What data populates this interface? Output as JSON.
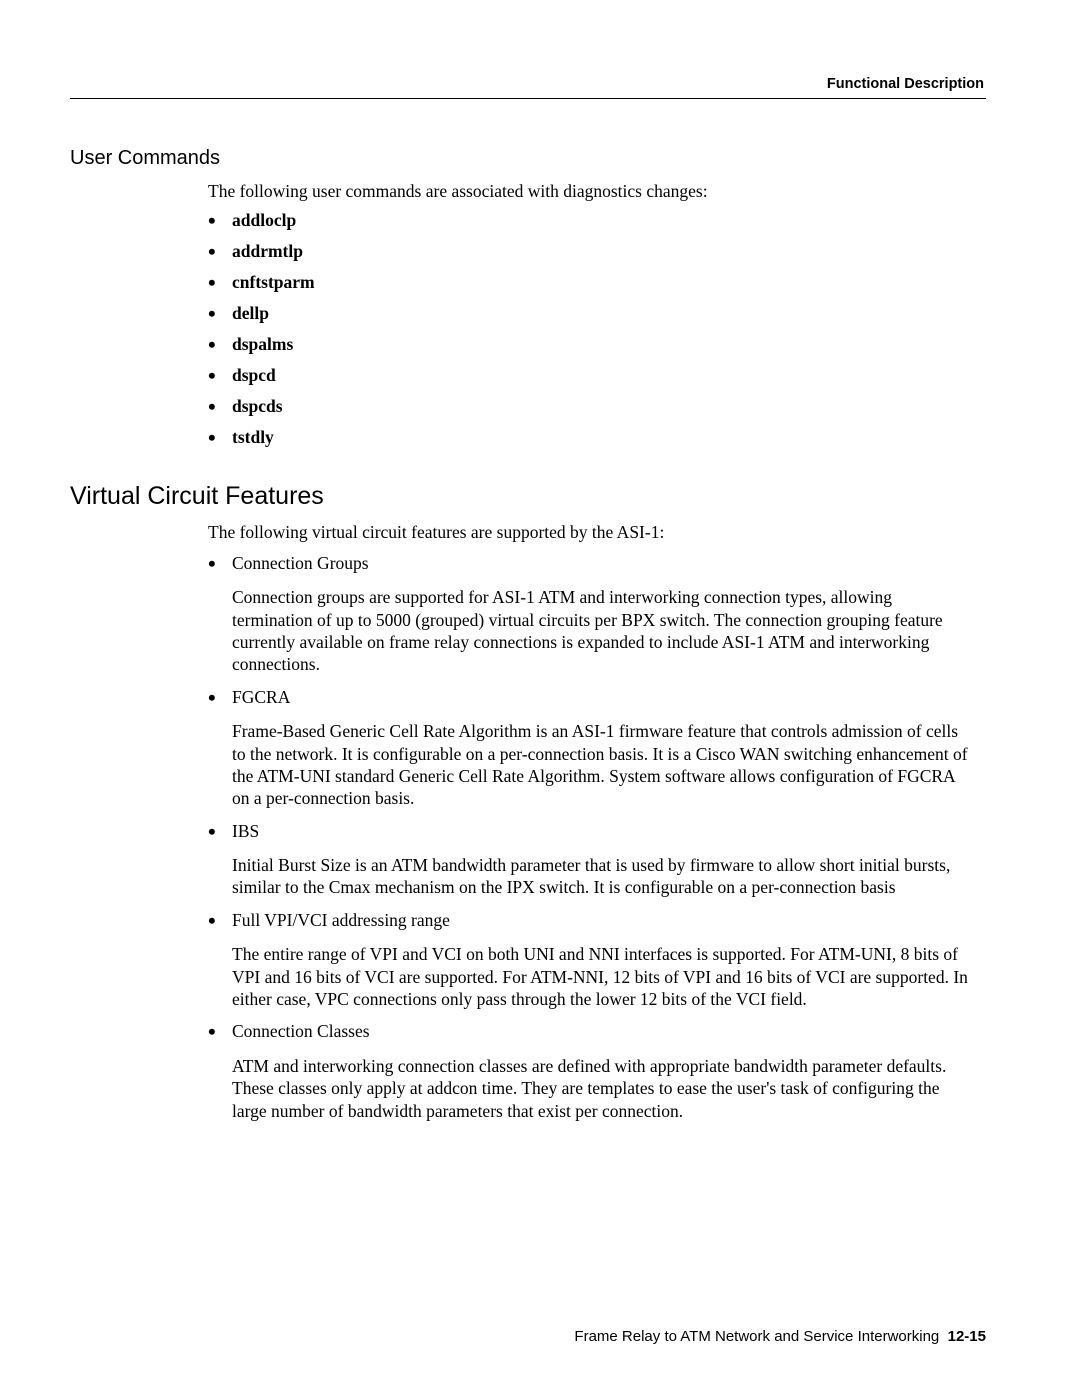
{
  "header": {
    "rightTitle": "Functional Description"
  },
  "sections": {
    "userCommands": {
      "heading": "User Commands",
      "intro": "The following user commands are associated with diagnostics changes:",
      "items": [
        "addloclp",
        "addrmtlp",
        "cnftstparm",
        "dellp",
        "dspalms",
        "dspcd",
        "dspcds",
        "tstdly"
      ]
    },
    "virtualCircuit": {
      "heading": "Virtual Circuit Features",
      "intro": "The following virtual circuit features are supported by the ASI-1:",
      "features": [
        {
          "title": "Connection Groups",
          "desc": "Connection groups are supported for ASI-1 ATM and interworking connection types, allowing termination of up to 5000 (grouped) virtual circuits per BPX switch. The connection grouping feature currently available on frame relay connections is expanded to include ASI-1 ATM and interworking connections."
        },
        {
          "title": "FGCRA",
          "desc": "Frame-Based Generic Cell Rate Algorithm is an ASI-1 firmware feature that controls admission of cells to the network. It is configurable on a per-connection basis. It is a Cisco WAN switching enhancement of the ATM-UNI standard Generic Cell Rate Algorithm. System software allows configuration of FGCRA on a per-connection basis."
        },
        {
          "title": "IBS",
          "desc": "Initial Burst Size is an ATM bandwidth parameter that is used by firmware to allow short initial bursts, similar to the Cmax mechanism on the IPX switch. It is configurable on a per-connection basis"
        },
        {
          "title": "Full VPI/VCI addressing range",
          "desc": "The entire range of VPI and VCI on both UNI and NNI interfaces is supported. For ATM-UNI, 8 bits of VPI and 16 bits of VCI are supported. For ATM-NNI, 12 bits of VPI and 16 bits of VCI are supported. In either case, VPC connections only pass through the lower 12 bits of the VCI field."
        },
        {
          "title": "Connection Classes",
          "desc": "ATM and interworking connection classes are defined with appropriate bandwidth parameter defaults. These classes only apply at addcon time. They are templates to ease the user's task of configuring the large number of bandwidth parameters that exist per connection."
        }
      ]
    }
  },
  "footer": {
    "text": "Frame Relay to ATM Network and Service Interworking",
    "page": "12-15"
  }
}
